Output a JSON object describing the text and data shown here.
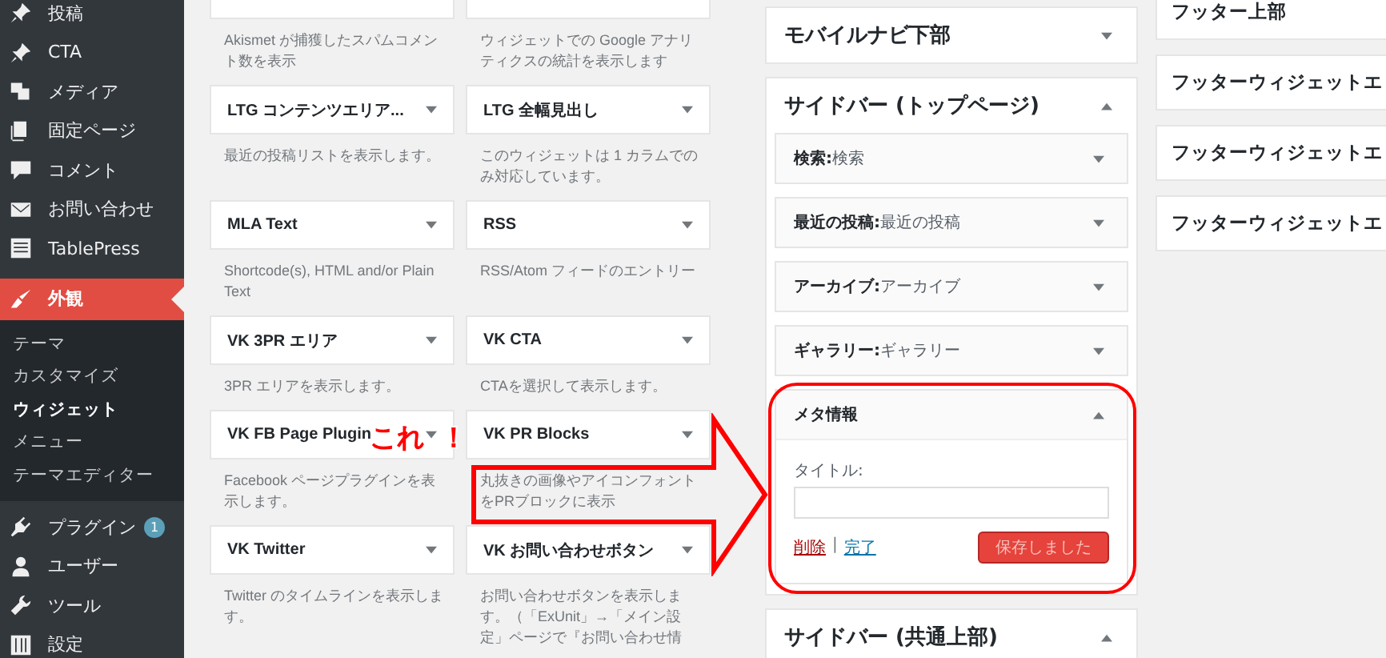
{
  "sidebar": {
    "items": [
      {
        "label": "投稿",
        "selected": false
      },
      {
        "label": "CTA",
        "selected": false
      },
      {
        "label": "メディア",
        "selected": false
      },
      {
        "label": "固定ページ",
        "selected": false
      },
      {
        "label": "コメント",
        "selected": false
      },
      {
        "label": "お問い合わせ",
        "selected": false
      },
      {
        "label": "TablePress",
        "selected": false
      },
      {
        "label": "外観",
        "selected": true,
        "children": [
          {
            "label": "テーマ",
            "selected": false
          },
          {
            "label": "カスタマイズ",
            "selected": false
          },
          {
            "label": "ウィジェット",
            "selected": true
          },
          {
            "label": "メニュー",
            "selected": false
          },
          {
            "label": "テーマエディター",
            "selected": false
          }
        ]
      },
      {
        "label": "プラグイン",
        "selected": false,
        "badge": "1"
      },
      {
        "label": "ユーザー",
        "selected": false
      },
      {
        "label": "ツール",
        "selected": false
      },
      {
        "label": "設定",
        "selected": false
      }
    ]
  },
  "available_widgets": [
    {
      "description": "Akismet が捕獲したスパムコメント数を表示"
    },
    {
      "description": "ウィジェットでの Google アナリティクスの統計を表示します"
    },
    {
      "title": "LTG コンテンツエリア...",
      "description": "最近の投稿リストを表示します。"
    },
    {
      "title": "LTG 全幅見出し",
      "description": "このウィジェットは 1 カラムでのみ対応しています。"
    },
    {
      "title": "MLA Text",
      "description": "Shortcode(s), HTML and/or Plain Text"
    },
    {
      "title": "RSS",
      "description": "RSS/Atom フィードのエントリー"
    },
    {
      "title": "VK 3PR エリア",
      "description": "3PR エリアを表示します。"
    },
    {
      "title": "VK CTA",
      "description": "CTAを選択して表示します。"
    },
    {
      "title": "VK FB Page Plugin",
      "description": "Facebook ページプラグインを表示します。"
    },
    {
      "title": "VK PR Blocks",
      "description": "丸抜きの画像やアイコンフォントをPRブロックに表示"
    },
    {
      "title": "VK Twitter",
      "description": "Twitter のタイムラインを表示します。"
    },
    {
      "title": "VK お問い合わせボタン",
      "description": "お問い合わせボタンを表示します。（「ExUnit」→「メイン設定」ページで『お問い合わせ情"
    }
  ],
  "widget_areas": [
    {
      "title": "モバイルナビ下部",
      "expanded": false
    },
    {
      "title": "サイドバー (トップページ)",
      "expanded": true,
      "widgets": [
        {
          "type": "検索:",
          "title": "検索",
          "expanded": false
        },
        {
          "type": "最近の投稿:",
          "title": "最近の投稿",
          "expanded": false
        },
        {
          "type": "アーカイブ:",
          "title": "アーカイブ",
          "expanded": false
        },
        {
          "type": "ギャラリー:",
          "title": "ギャラリー",
          "expanded": false
        },
        {
          "type": "メタ情報",
          "expanded": true,
          "highlighted": true,
          "form": {
            "field_label": "タイトル:",
            "delete": "削除",
            "separator": "|",
            "done": "完了",
            "save": "保存しました",
            "save_disabled": true
          }
        }
      ]
    },
    {
      "title": "サイドバー (共通上部)",
      "expanded": true
    }
  ],
  "footer_areas": [
    {
      "title": "フッター上部"
    },
    {
      "title": "フッターウィジェットエ"
    },
    {
      "title": "フッターウィジェットエ"
    },
    {
      "title": "フッターウィジェットエ"
    }
  ],
  "annotation": {
    "callout": [
      "これ",
      "！"
    ]
  }
}
